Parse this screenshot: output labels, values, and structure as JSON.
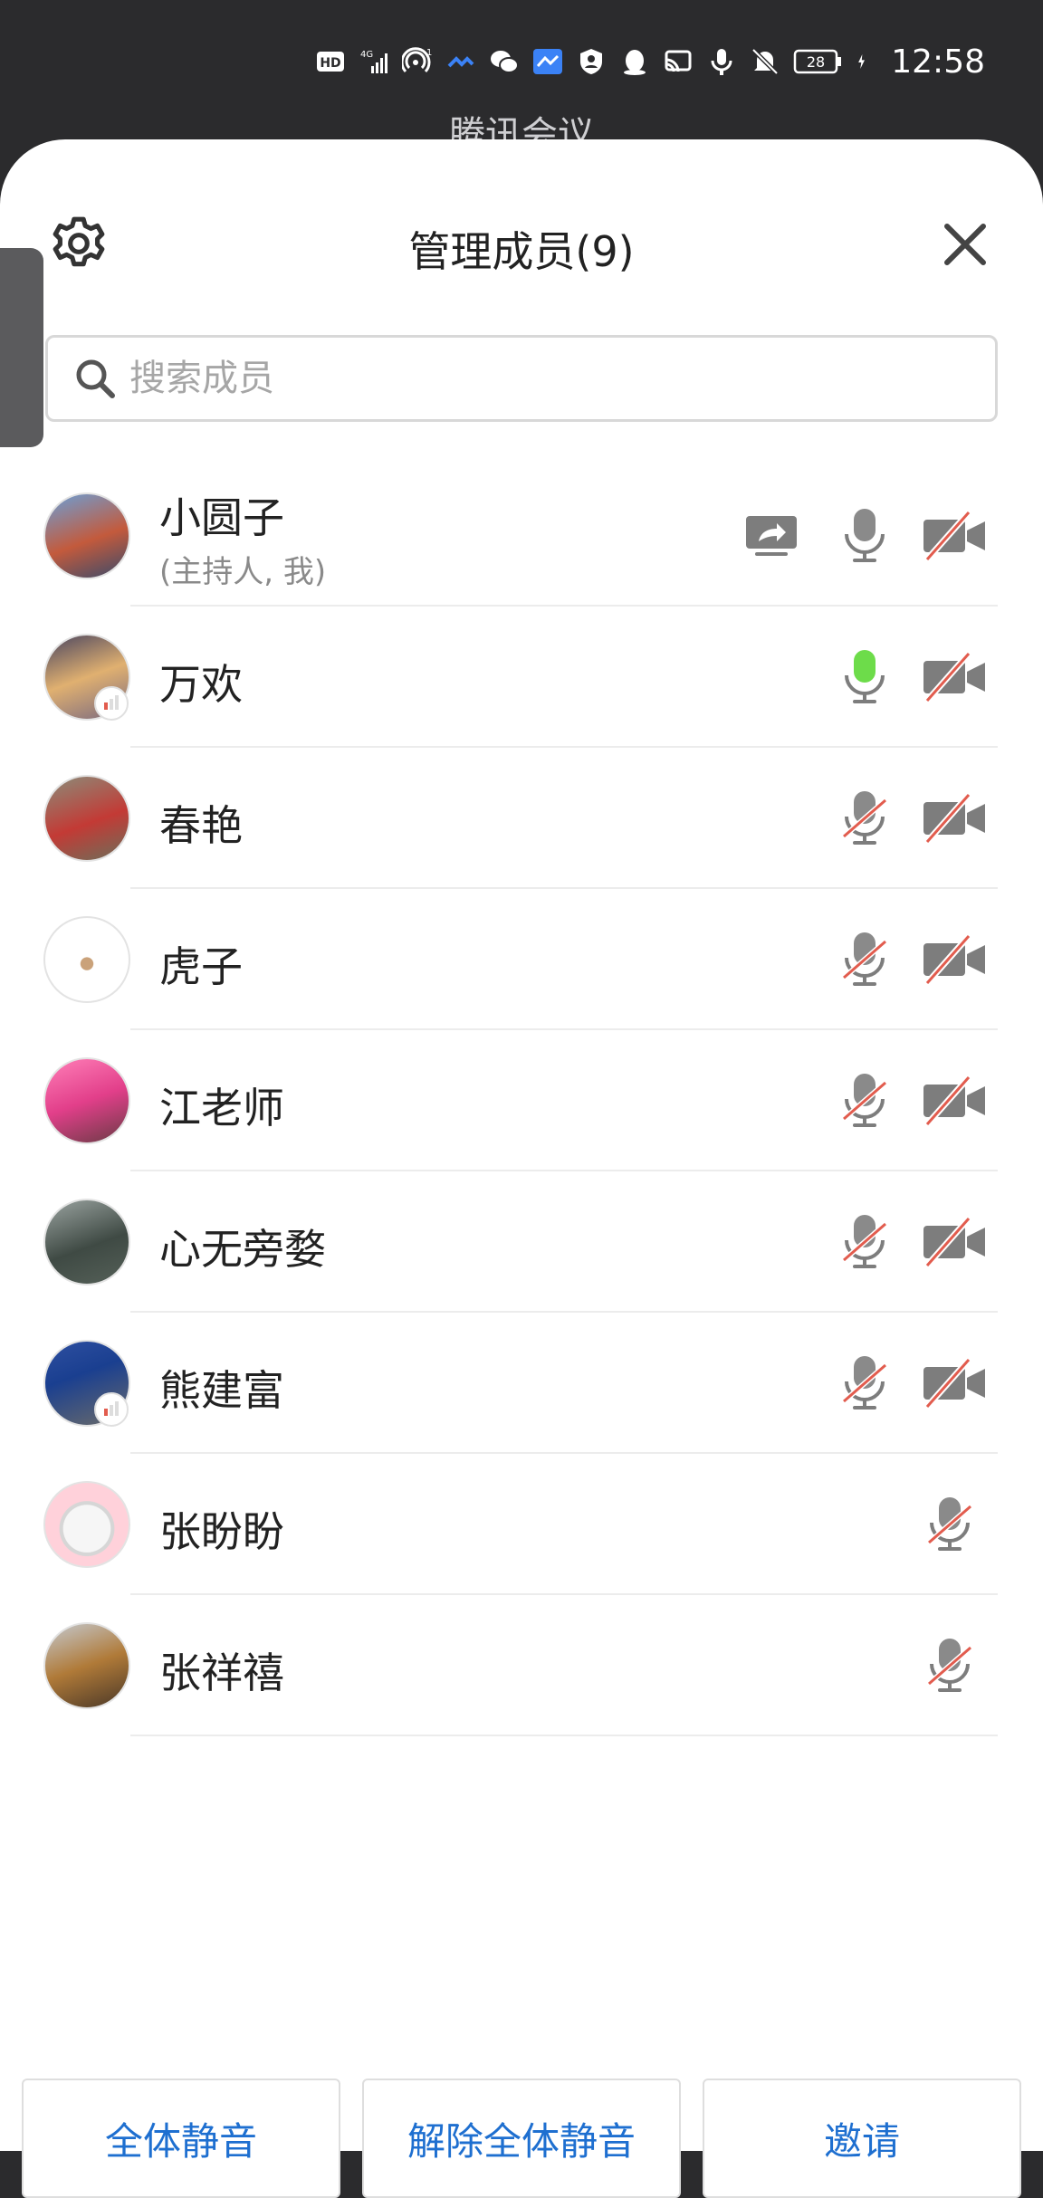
{
  "status_bar": {
    "time": "12:58",
    "battery": "28",
    "network_small": "4G",
    "hotspot_count": "1"
  },
  "behind": {
    "app_title": "腾讯会议"
  },
  "header": {
    "title": "管理成员(9)"
  },
  "search": {
    "placeholder": "搜索成员",
    "value": ""
  },
  "members": [
    {
      "name": "小圆子",
      "subtitle": "(主持人, 我)",
      "share": true,
      "mic": "on",
      "camera": "off",
      "signal": false
    },
    {
      "name": "万欢",
      "subtitle": "",
      "share": false,
      "mic": "speaking",
      "camera": "off",
      "signal": true
    },
    {
      "name": "春艳",
      "subtitle": "",
      "share": false,
      "mic": "off",
      "camera": "off",
      "signal": false
    },
    {
      "name": "虎子",
      "subtitle": "",
      "share": false,
      "mic": "off",
      "camera": "off",
      "signal": false
    },
    {
      "name": "江老师",
      "subtitle": "",
      "share": false,
      "mic": "off",
      "camera": "off",
      "signal": false
    },
    {
      "name": "心无旁婺",
      "subtitle": "",
      "share": false,
      "mic": "off",
      "camera": "off",
      "signal": false
    },
    {
      "name": "熊建富",
      "subtitle": "",
      "share": false,
      "mic": "off",
      "camera": "off",
      "signal": true
    },
    {
      "name": "张盼盼",
      "subtitle": "",
      "share": false,
      "mic": "off",
      "camera": "none",
      "signal": false
    },
    {
      "name": "张祥禧",
      "subtitle": "",
      "share": false,
      "mic": "off",
      "camera": "none",
      "signal": false
    }
  ],
  "footer": {
    "mute_all": "全体静音",
    "unmute_all": "解除全体静音",
    "invite": "邀请"
  },
  "colors": {
    "accent": "#1e6fd0",
    "speaking": "#6ddc4a",
    "muted_slash": "#e25c4e",
    "icon_gray": "#7d7d7d"
  }
}
